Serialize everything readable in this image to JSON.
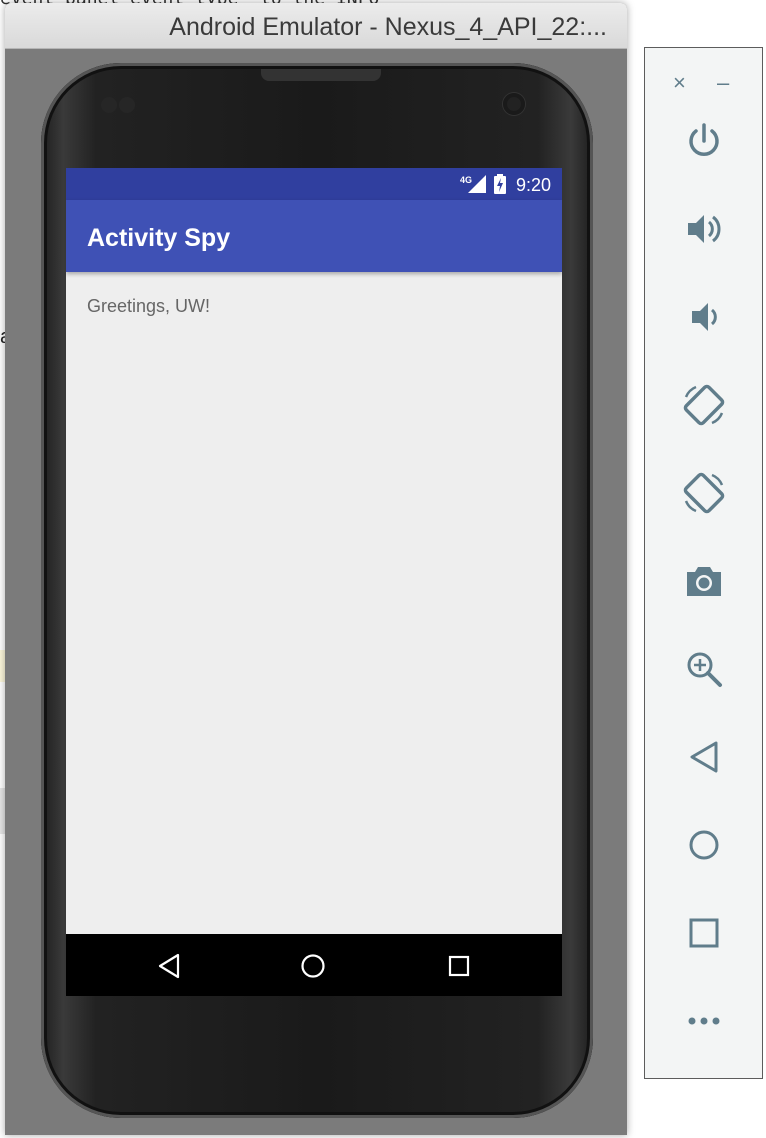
{
  "background": {
    "code_snippet": "event_panel_event_type\" to the INFO",
    "stray_letter": "a"
  },
  "window": {
    "title": "Android Emulator - Nexus_4_API_22:..."
  },
  "status_bar": {
    "network": "4G",
    "time": "9:20"
  },
  "app": {
    "title": "Activity Spy",
    "greeting": "Greetings, UW!",
    "colors": {
      "primary": "#3f51b5",
      "primary_dark": "#303f9f",
      "background": "#eeeeee"
    }
  },
  "nav_bar": {
    "back_icon": "back-triangle-icon",
    "home_icon": "home-circle-icon",
    "recents_icon": "recents-square-icon"
  },
  "side_panel": {
    "close": "×",
    "minimize": "–",
    "controls": [
      "power",
      "volume-up",
      "volume-down",
      "rotate-left",
      "rotate-right",
      "screenshot",
      "zoom",
      "back",
      "home",
      "overview",
      "more"
    ],
    "icon_color": "#607d8b"
  }
}
